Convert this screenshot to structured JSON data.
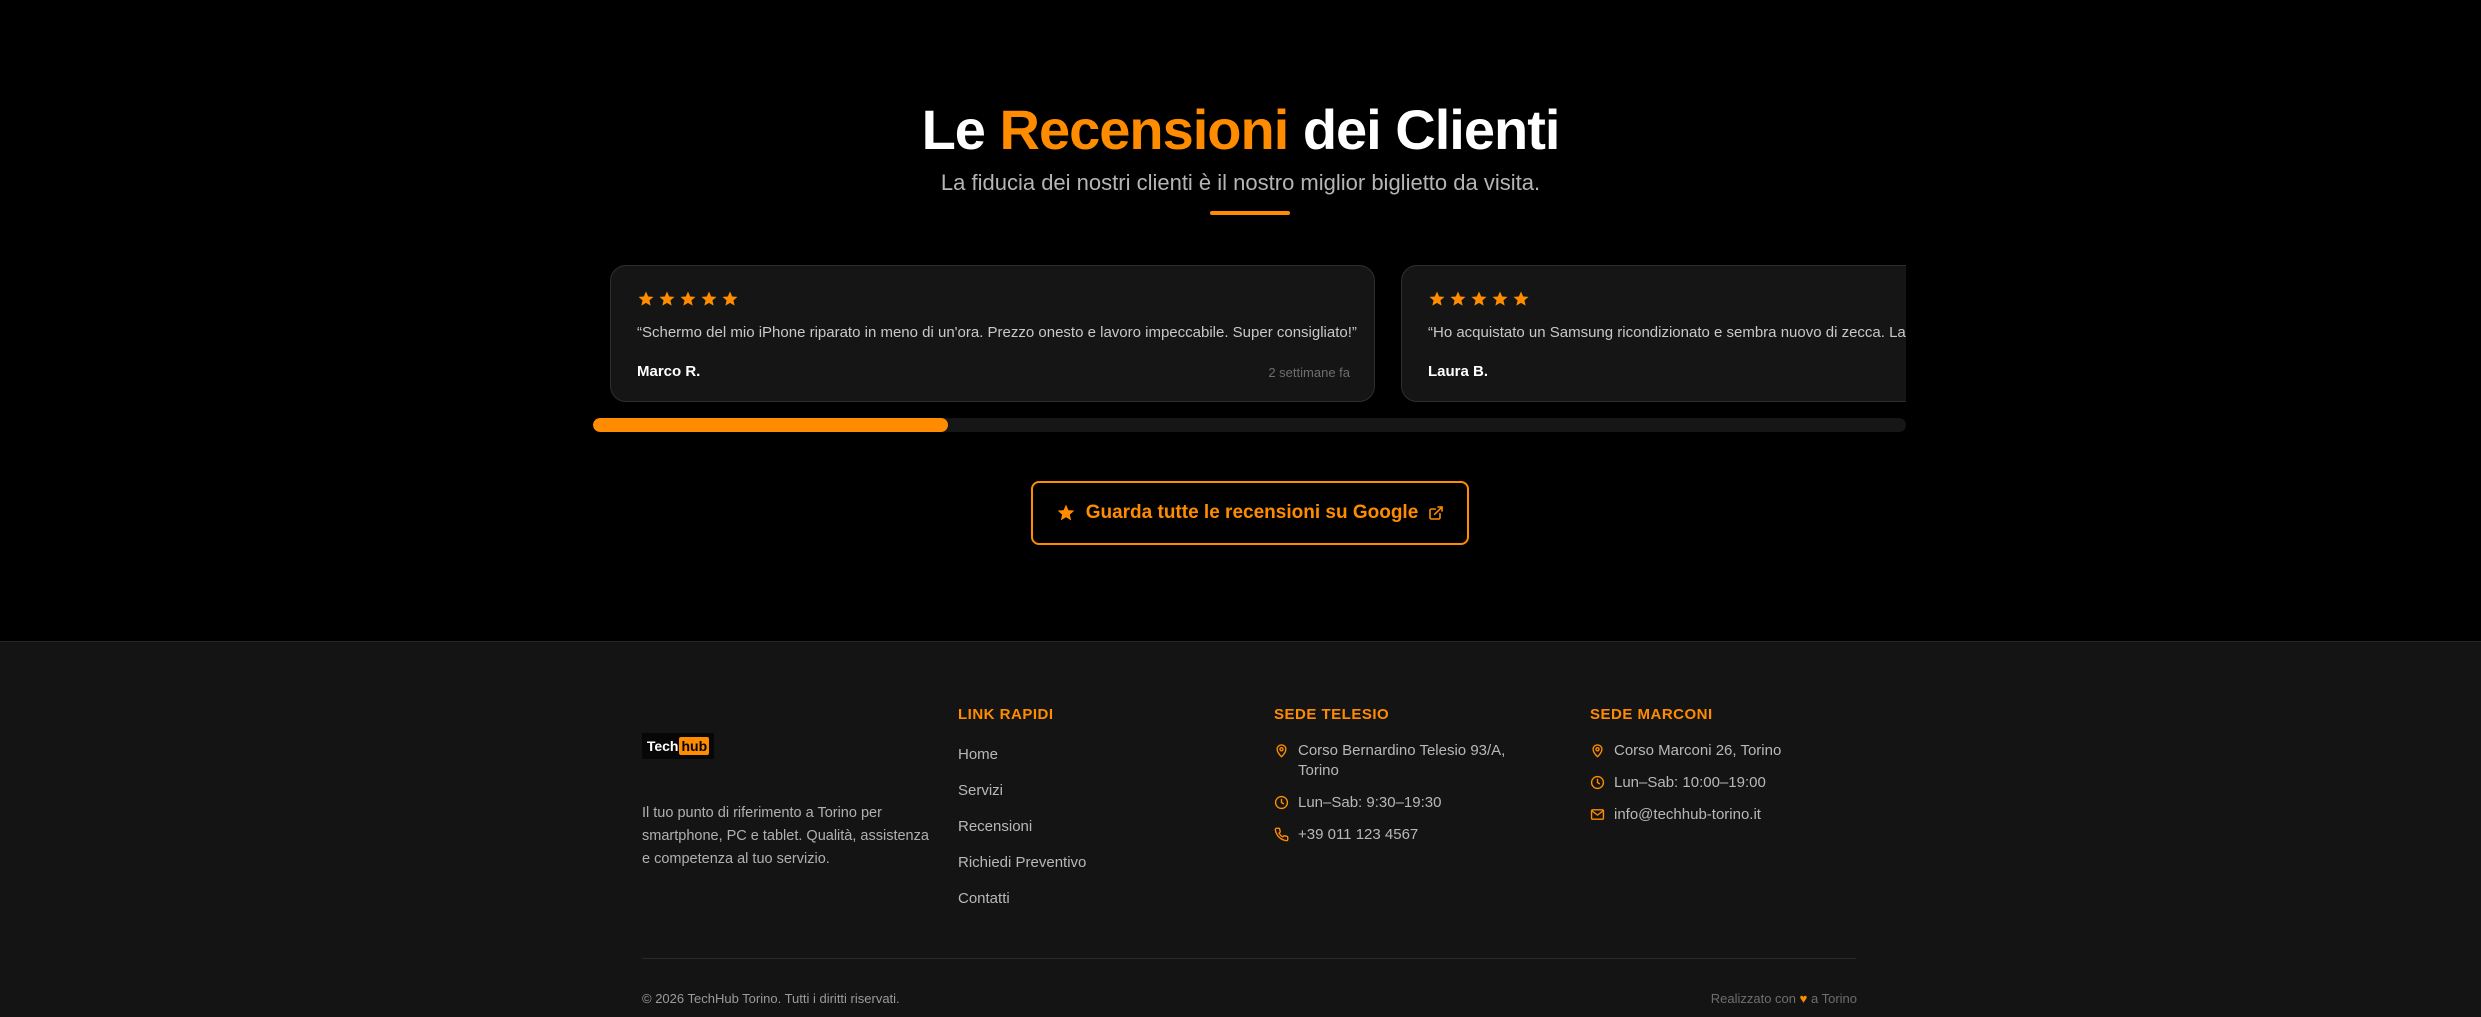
{
  "reviews": {
    "title_pre": "Le",
    "title_accent": "Recensioni",
    "title_post": "dei Clienti",
    "subtitle": "La fiducia dei nostri clienti è il nostro miglior biglietto da visita.",
    "items": [
      {
        "quote": "“Schermo del mio iPhone riparato in meno di un'ora. Prezzo onesto e lavoro impeccabile. Super consigliato!”",
        "author": "Marco R.",
        "ago": "2 settimane fa",
        "rating": 5
      },
      {
        "quote": "“Ho acquistato un Samsung ricondizionato e sembra nuovo di zecca. La qualità è ottima!”",
        "author": "Laura B.",
        "ago": "",
        "rating": 5
      }
    ],
    "progress": 0.27,
    "google_button": "Guarda tutte le recensioni su Google"
  },
  "footer": {
    "logo_tech": "Tech",
    "logo_hub": "hub",
    "about": "Il tuo punto di riferimento a Torino per smartphone, PC e tablet. Qualità, assistenza e competenza al tuo servizio.",
    "links_title": "LINK RAPIDI",
    "links": [
      "Home",
      "Servizi",
      "Recensioni",
      "Richiedi Preventivo",
      "Contatti"
    ],
    "telesio": {
      "title": "SEDE TELESIO",
      "address": "Corso Bernardino Telesio 93/A, Torino",
      "hours": "Lun–Sab: 9:30–19:30",
      "phone": "+39 011 123 4567"
    },
    "marconi": {
      "title": "SEDE MARCONI",
      "address": "Corso Marconi 26, Torino",
      "hours": "Lun–Sab: 10:00–19:00",
      "email": "info@techhub-torino.it"
    },
    "copyright": "© 2026 TechHub Torino. Tutti i diritti riservati.",
    "made_pre": "Realizzato con",
    "made_post": "a Torino"
  },
  "colors": {
    "accent": "#ff8c00",
    "background": "#000000",
    "footer_bg": "#141414"
  },
  "icons": [
    "star-icon",
    "external-link-icon",
    "map-pin-icon",
    "clock-icon",
    "phone-icon",
    "mail-icon",
    "heart-icon"
  ]
}
